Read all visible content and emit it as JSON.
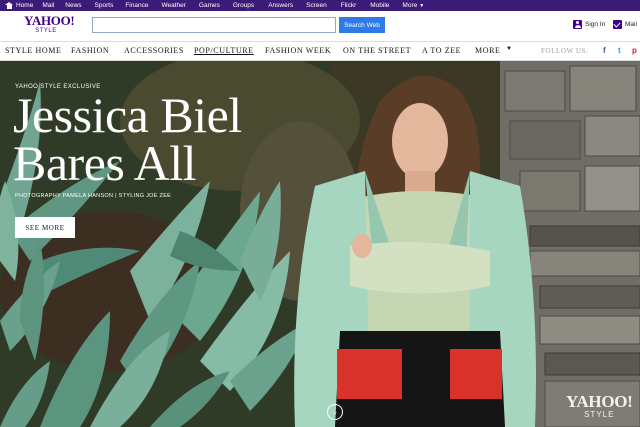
{
  "topbar": {
    "items": [
      "Home",
      "Mail",
      "News",
      "Sports",
      "Finance",
      "Weather",
      "Games",
      "Groups",
      "Answers",
      "Screen",
      "Flickr",
      "Mobile",
      "More"
    ]
  },
  "header": {
    "logo": {
      "brand": "YAHOO!",
      "sub": "STYLE"
    },
    "search": {
      "value": "",
      "button_label": "Search Web"
    },
    "sign_in": "Sign In",
    "mail": "Mail"
  },
  "nav": {
    "items": [
      "STYLE HOME",
      "FASHION",
      "ACCESSORIES",
      "POP/CULTURE",
      "FASHION WEEK",
      "ON THE STREET",
      "A TO ZEE",
      "MORE"
    ],
    "active": "POP/CULTURE",
    "follow_label": "FOLLOW US:",
    "social": [
      "f",
      "t",
      "p"
    ]
  },
  "hero": {
    "eyebrow": "YAHOO STYLE EXCLUSIVE",
    "headline_line1": "Jessica Biel",
    "headline_line2": "Bares All",
    "credit": "PHOTOGRAPHY PAMELA HANSON | STYLING JOE ZEE",
    "cta": "SEE MORE",
    "watermark_brand": "YAHOO!",
    "watermark_sub": "STYLE"
  },
  "colors": {
    "brand_purple": "#400090",
    "topbar": "#3c1a78",
    "search_button": "#2e7be6",
    "facebook": "#3b5998",
    "twitter": "#1da1f2",
    "pinterest": "#cb2027"
  },
  "icons": {
    "home": "home-icon",
    "sign_in": "user-icon",
    "mail": "mail-icon",
    "scroll": "chevron-down-icon"
  }
}
